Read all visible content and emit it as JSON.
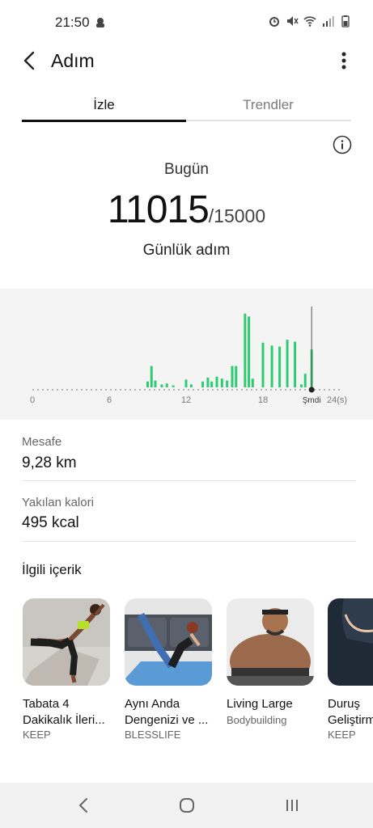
{
  "status": {
    "time": "21:50"
  },
  "header": {
    "title": "Adım"
  },
  "tabs": [
    {
      "label": "İzle"
    },
    {
      "label": "Trendler"
    }
  ],
  "today": {
    "label": "Bugün",
    "steps": "11015",
    "goal": "/15000",
    "caption": "Günlük adım"
  },
  "chart_data": {
    "type": "bar",
    "x_ticks": [
      "0",
      "6",
      "12",
      "18",
      "Şmdi",
      "24(s)"
    ],
    "x": [
      9.0,
      9.3,
      9.6,
      10.1,
      10.5,
      11.0,
      12.0,
      12.4,
      13.3,
      13.7,
      14.0,
      14.4,
      14.8,
      15.2,
      15.6,
      15.9,
      16.6,
      16.9,
      17.2,
      18.0,
      18.7,
      19.3,
      19.9,
      20.5,
      21.0,
      21.3,
      21.8
    ],
    "values": [
      600,
      2200,
      700,
      300,
      400,
      200,
      800,
      300,
      600,
      1000,
      600,
      1100,
      900,
      700,
      2200,
      2200,
      7600,
      7300,
      900,
      4600,
      4300,
      4200,
      4900,
      4700,
      300,
      1400,
      3900
    ],
    "now": 21.8,
    "xlim": [
      0,
      24
    ]
  },
  "metrics": [
    {
      "label": "Mesafe",
      "value": "9,28 km"
    },
    {
      "label": "Yakılan kalori",
      "value": "495 kcal"
    }
  ],
  "related": {
    "title": "İlgili içerik",
    "cards": [
      {
        "title1": "Tabata 4",
        "title2": "Dakikalık İleri...",
        "source": "KEEP",
        "icon": "fitness-woman-photo"
      },
      {
        "title1": "Aynı Anda",
        "title2": "Dengenizi ve ...",
        "source": "BLESSLIFE",
        "icon": "yoga-mat-photo"
      },
      {
        "title1": "Living Large",
        "title2": "",
        "source": "Bodybuilding",
        "icon": "bodybuilder-photo"
      },
      {
        "title1": "Duruş",
        "title2": "Geliştirm",
        "source": "KEEP",
        "icon": "posture-photo"
      }
    ]
  },
  "colors": {
    "accent_bar": "#2ecc71",
    "chart_bg": "#f4f4f4"
  }
}
